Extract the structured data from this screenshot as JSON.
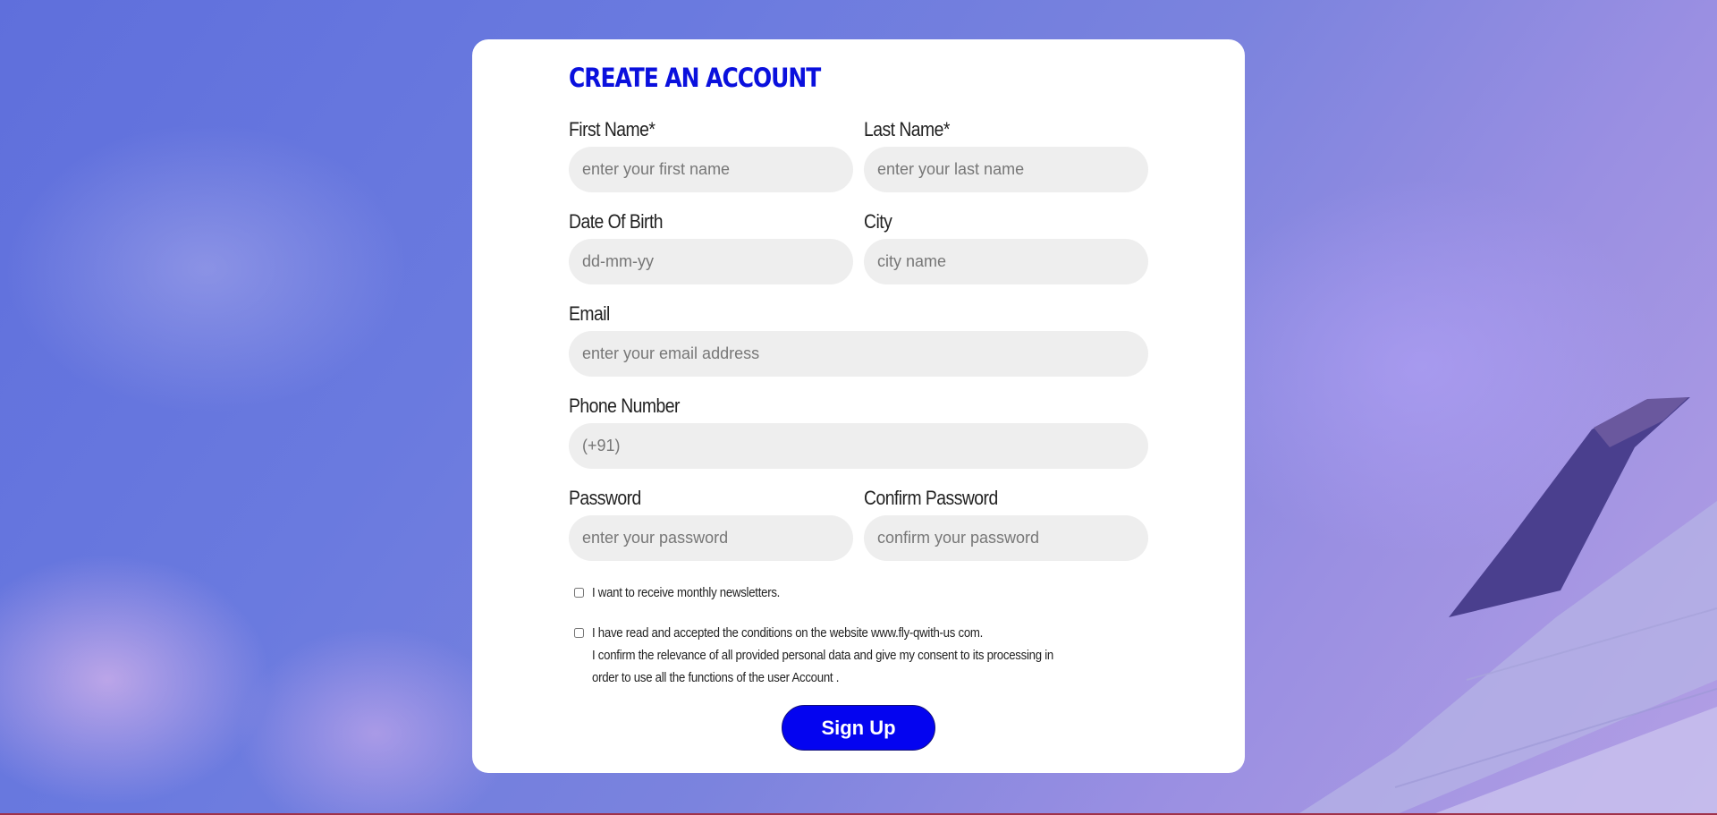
{
  "page": {
    "title": "CREATE AN ACCOUNT"
  },
  "form": {
    "first_name": {
      "label": "First Name*",
      "placeholder": "enter your first name"
    },
    "last_name": {
      "label": "Last Name*",
      "placeholder": "enter your last name"
    },
    "dob": {
      "label": "Date Of Birth",
      "placeholder": "dd-mm-yy"
    },
    "city": {
      "label": "City",
      "placeholder": "city name"
    },
    "email": {
      "label": "Email",
      "placeholder": "enter your email address"
    },
    "phone": {
      "label": "Phone Number",
      "placeholder": "(+91)"
    },
    "password": {
      "label": "Password",
      "placeholder": "enter your password"
    },
    "confirm_password": {
      "label": "Confirm Password",
      "placeholder": "confirm your password"
    },
    "newsletter": {
      "label": "I want to receive monthly newsletters.",
      "checked": false
    },
    "terms": {
      "line1": "I have read and accepted the conditions on the website www.fly-qwith-us com.",
      "line2": "I confirm the relevance of all provided personal data and give my consent to its processing in order to use all the functions of the user Account .",
      "checked": false
    },
    "submit_label": "Sign Up"
  },
  "colors": {
    "title": "#0a10dd",
    "button": "#0404f0",
    "input_bg": "#eeeeee"
  }
}
